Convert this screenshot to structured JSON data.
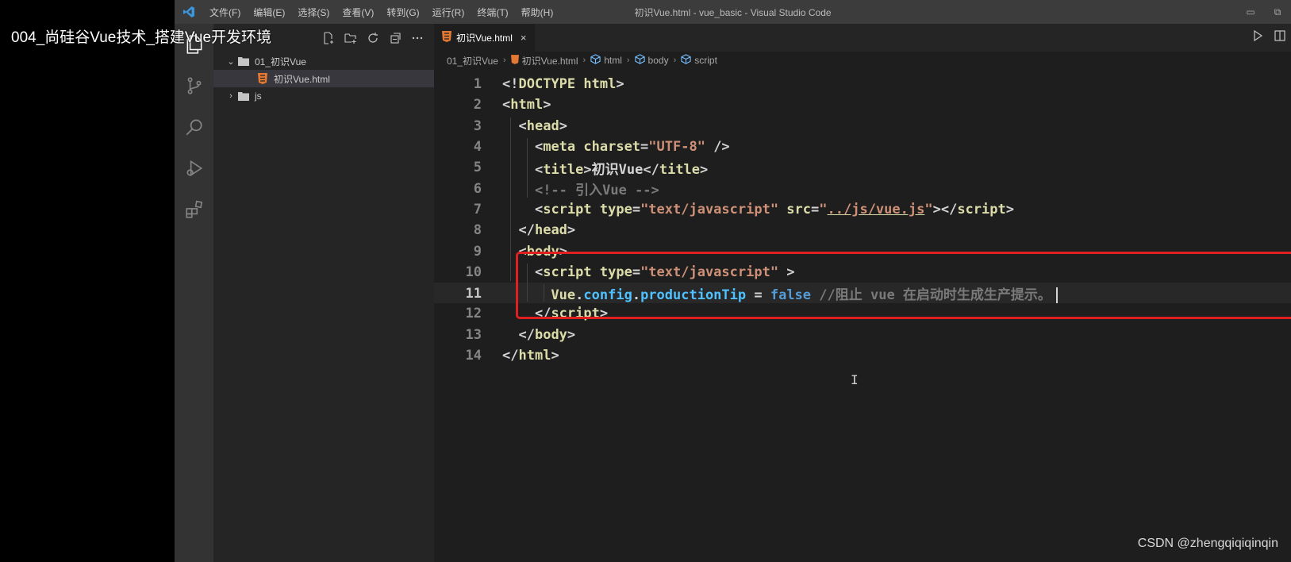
{
  "video_title": "004_尚硅谷Vue技术_搭建Vue开发环境",
  "window": {
    "menu": [
      "文件(F)",
      "编辑(E)",
      "选择(S)",
      "查看(V)",
      "转到(G)",
      "运行(R)",
      "终端(T)",
      "帮助(H)"
    ],
    "title": "初识Vue.html - vue_basic - Visual Studio Code"
  },
  "sidebar": {
    "workspace_label": "...",
    "tree": [
      {
        "label": "01_初识Vue",
        "type": "folder",
        "expanded": true
      },
      {
        "label": "初识Vue.html",
        "type": "html-file",
        "selected": true
      },
      {
        "label": "js",
        "type": "folder",
        "expanded": false
      }
    ]
  },
  "editor": {
    "tab": {
      "label": "初识Vue.html",
      "close": "×"
    },
    "breadcrumb": [
      "01_初识Vue",
      "初识Vue.html",
      "html",
      "body",
      "script"
    ],
    "active_line": 11,
    "lines": [
      {
        "n": "1",
        "tokens": [
          [
            "tk-bracket",
            "<!"
          ],
          [
            "tk-tag",
            "DOCTYPE html"
          ],
          [
            "tk-bracket",
            ">"
          ]
        ]
      },
      {
        "n": "2",
        "tokens": [
          [
            "tk-bracket",
            "<"
          ],
          [
            "tk-tag",
            "html"
          ],
          [
            "tk-bracket",
            ">"
          ]
        ]
      },
      {
        "n": "3",
        "tokens": [
          [
            "tk-text",
            "  "
          ],
          [
            "tk-bracket",
            "<"
          ],
          [
            "tk-tag",
            "head"
          ],
          [
            "tk-bracket",
            ">"
          ]
        ]
      },
      {
        "n": "4",
        "tokens": [
          [
            "tk-text",
            "    "
          ],
          [
            "tk-bracket",
            "<"
          ],
          [
            "tk-tag",
            "meta "
          ],
          [
            "tk-attr",
            "charset"
          ],
          [
            "tk-bracket",
            "="
          ],
          [
            "tk-str",
            "\"UTF-8\""
          ],
          [
            "tk-bracket",
            " />"
          ]
        ]
      },
      {
        "n": "5",
        "tokens": [
          [
            "tk-text",
            "    "
          ],
          [
            "tk-bracket",
            "<"
          ],
          [
            "tk-tag",
            "title"
          ],
          [
            "tk-bracket",
            ">"
          ],
          [
            "tk-text",
            "初识Vue"
          ],
          [
            "tk-bracket",
            "</"
          ],
          [
            "tk-tag",
            "title"
          ],
          [
            "tk-bracket",
            ">"
          ]
        ]
      },
      {
        "n": "6",
        "tokens": [
          [
            "tk-text",
            "    "
          ],
          [
            "tk-comment",
            "<!-- 引入Vue -->"
          ]
        ]
      },
      {
        "n": "7",
        "tokens": [
          [
            "tk-text",
            "    "
          ],
          [
            "tk-bracket",
            "<"
          ],
          [
            "tk-tag",
            "script "
          ],
          [
            "tk-attr",
            "type"
          ],
          [
            "tk-bracket",
            "="
          ],
          [
            "tk-str",
            "\"text/javascript\" "
          ],
          [
            "tk-attr",
            "src"
          ],
          [
            "tk-bracket",
            "="
          ],
          [
            "tk-str",
            "\""
          ],
          [
            "tk-link",
            "../js/vue.js"
          ],
          [
            "tk-str",
            "\""
          ],
          [
            "tk-bracket",
            "></"
          ],
          [
            "tk-tag",
            "script"
          ],
          [
            "tk-bracket",
            ">"
          ]
        ]
      },
      {
        "n": "8",
        "tokens": [
          [
            "tk-text",
            "  "
          ],
          [
            "tk-bracket",
            "</"
          ],
          [
            "tk-tag",
            "head"
          ],
          [
            "tk-bracket",
            ">"
          ]
        ]
      },
      {
        "n": "9",
        "tokens": [
          [
            "tk-text",
            "  "
          ],
          [
            "tk-bracket",
            "<"
          ],
          [
            "tk-tag",
            "body"
          ],
          [
            "tk-bracket",
            ">"
          ]
        ]
      },
      {
        "n": "10",
        "tokens": [
          [
            "tk-text",
            "    "
          ],
          [
            "tk-bracket",
            "<"
          ],
          [
            "tk-tag",
            "script "
          ],
          [
            "tk-attr",
            "type"
          ],
          [
            "tk-bracket",
            "="
          ],
          [
            "tk-str",
            "\"text/javascript\""
          ],
          [
            "tk-bracket",
            " >"
          ]
        ]
      },
      {
        "n": "11",
        "tokens": [
          [
            "tk-text",
            "      "
          ],
          [
            "tk-obj",
            "Vue"
          ],
          [
            "tk-text",
            "."
          ],
          [
            "tk-prop",
            "config"
          ],
          [
            "tk-text",
            "."
          ],
          [
            "tk-prop",
            "productionTip"
          ],
          [
            "tk-text",
            " = "
          ],
          [
            "tk-kw",
            "false"
          ],
          [
            "tk-text",
            " "
          ],
          [
            "tk-comment",
            "//阻止 vue 在启动时生成生产提示。"
          ]
        ]
      },
      {
        "n": "12",
        "tokens": [
          [
            "tk-text",
            "    "
          ],
          [
            "tk-bracket",
            "</"
          ],
          [
            "tk-tag",
            "script"
          ],
          [
            "tk-bracket",
            ">"
          ]
        ]
      },
      {
        "n": "13",
        "tokens": [
          [
            "tk-text",
            "  "
          ],
          [
            "tk-bracket",
            "</"
          ],
          [
            "tk-tag",
            "body"
          ],
          [
            "tk-bracket",
            ">"
          ]
        ]
      },
      {
        "n": "14",
        "tokens": [
          [
            "tk-bracket",
            "</"
          ],
          [
            "tk-tag",
            "html"
          ],
          [
            "tk-bracket",
            ">"
          ]
        ]
      }
    ]
  },
  "watermark": "CSDN @zhengqiqiqinqin",
  "colors": {
    "highlight_box": "#e02020",
    "vscode_blue": "#3a96dd",
    "html_icon": "#e37933"
  }
}
